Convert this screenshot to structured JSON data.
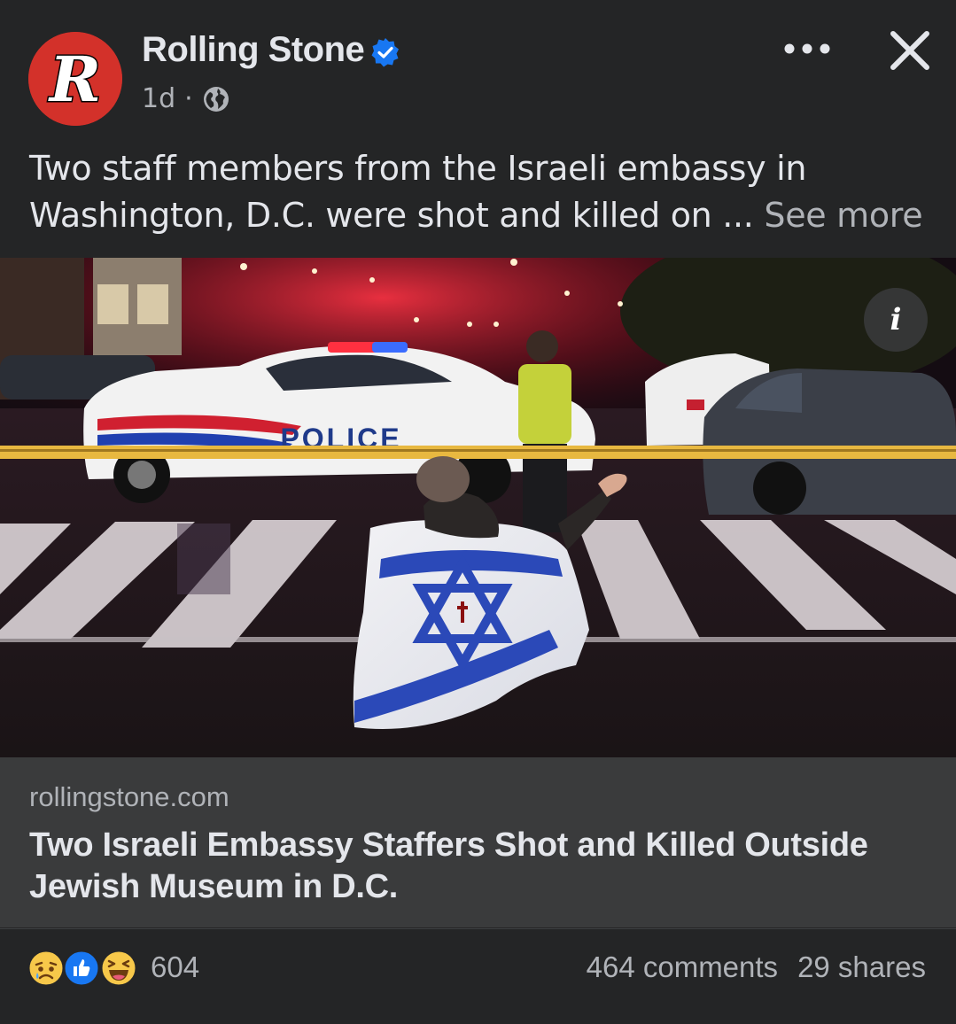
{
  "post": {
    "page_name": "Rolling Stone",
    "avatar_letter": "R",
    "timestamp": "1d",
    "separator": "·",
    "caption_text": "Two staff members from the Israeli embassy in Washington, D.C. were shot and killed on ...",
    "see_more": "See more"
  },
  "image": {
    "info_label": "i",
    "police_text": "POLICE"
  },
  "link": {
    "domain": "rollingstone.com",
    "title": "Two Israeli Embassy Staffers Shot and Killed Outside Jewish Museum in D.C."
  },
  "footer": {
    "reaction_count": "604",
    "comments": "464 comments",
    "shares": "29 shares",
    "reactions": [
      "sad",
      "like",
      "haha"
    ]
  },
  "colors": {
    "background": "#242526",
    "card": "#3a3b3c",
    "text_primary": "#e4e6eb",
    "text_secondary": "#b0b3b8",
    "verified_blue": "#1877f2",
    "brand_red": "#d3312a"
  },
  "icons": {
    "verified": "verified-badge-icon",
    "globe": "globe-icon",
    "more": "more-options-icon",
    "close": "close-icon",
    "info": "info-icon"
  }
}
